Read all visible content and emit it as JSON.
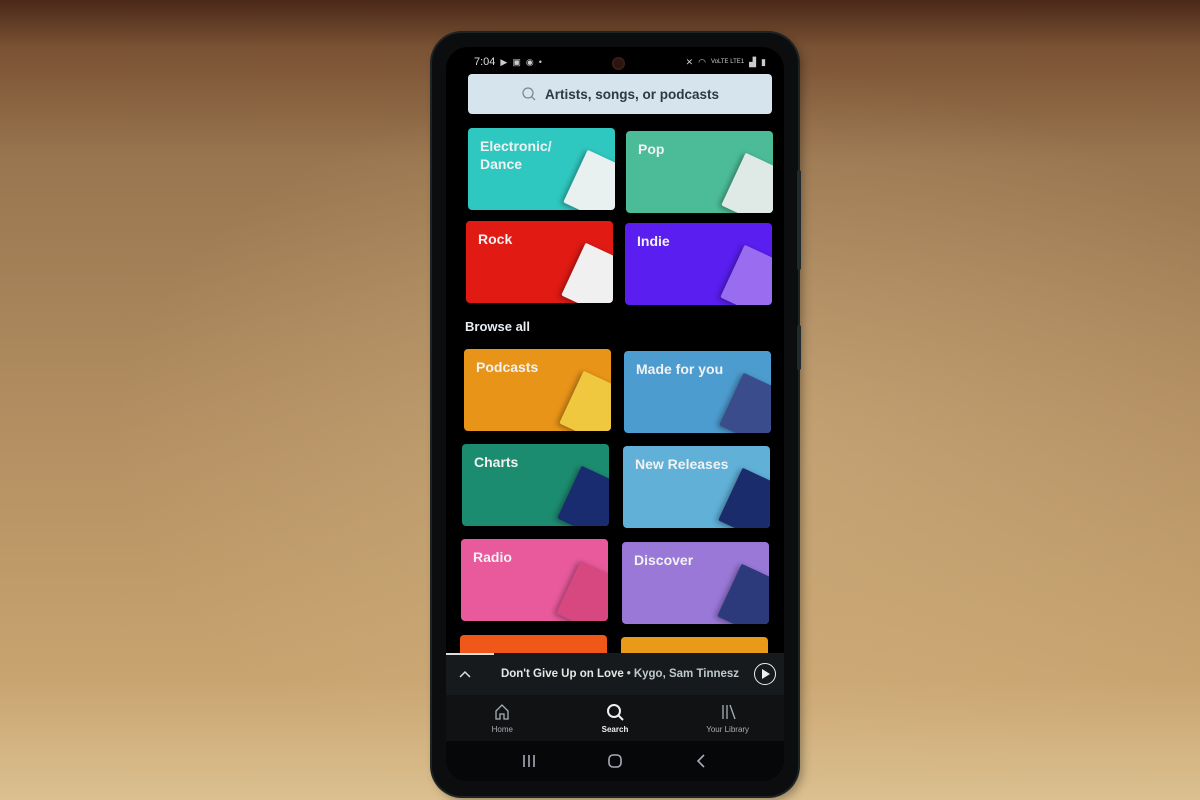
{
  "status_bar": {
    "time": "7:04",
    "left_icons": [
      "play-store-icon",
      "gallery-icon",
      "messenger-icon",
      "dot-icon"
    ],
    "right_icons": [
      "mute-icon",
      "wifi-icon",
      "volte-lte-icon",
      "signal-icon",
      "battery-icon"
    ],
    "network_label": "VoLTE LTE1"
  },
  "search": {
    "placeholder": "Artists, songs, or podcasts"
  },
  "top_genres": [
    {
      "label": "Electronic/\nDance",
      "color": "#2fc8c0",
      "art_color": "#e8f0f0"
    },
    {
      "label": "Pop",
      "color": "#4cbc98",
      "art_color": "#dfe9e6"
    },
    {
      "label": "Rock",
      "color": "#e11a14",
      "art_color": "#f0f0f0"
    },
    {
      "label": "Indie",
      "color": "#5a1ef0",
      "art_color": "#9a6cf0"
    }
  ],
  "browse_all": {
    "title": "Browse all",
    "categories": [
      {
        "label": "Podcasts",
        "color": "#e89418",
        "art_color": "#f0c840"
      },
      {
        "label": "Made for you",
        "color": "#4d9cd0",
        "art_color": "#3a4c8c"
      },
      {
        "label": "Charts",
        "color": "#1c8c70",
        "art_color": "#1a2c70"
      },
      {
        "label": "New Releases",
        "color": "#60b0d8",
        "art_color": "#1a2c6c"
      },
      {
        "label": "Radio",
        "color": "#e85a9c",
        "art_color": "#d84880"
      },
      {
        "label": "Discover",
        "color": "#9a78d8",
        "art_color": "#2c3a7c"
      },
      {
        "label": "",
        "color": "#f0581a",
        "art_color": "#f0581a"
      },
      {
        "label": "",
        "color": "#e89a18",
        "art_color": "#e89a18"
      }
    ]
  },
  "now_playing": {
    "title": "Don't Give Up on Love",
    "separator": "•",
    "artists": "Kygo, Sam Tinnesz",
    "expand_icon": "chevron-up-icon",
    "play_icon": "play-icon"
  },
  "tabs": [
    {
      "label": "Home",
      "icon": "home-icon",
      "active": false
    },
    {
      "label": "Search",
      "icon": "search-icon",
      "active": true
    },
    {
      "label": "Your Library",
      "icon": "library-icon",
      "active": false
    }
  ],
  "system_nav": [
    "recents-icon",
    "home-circle-icon",
    "back-icon"
  ]
}
